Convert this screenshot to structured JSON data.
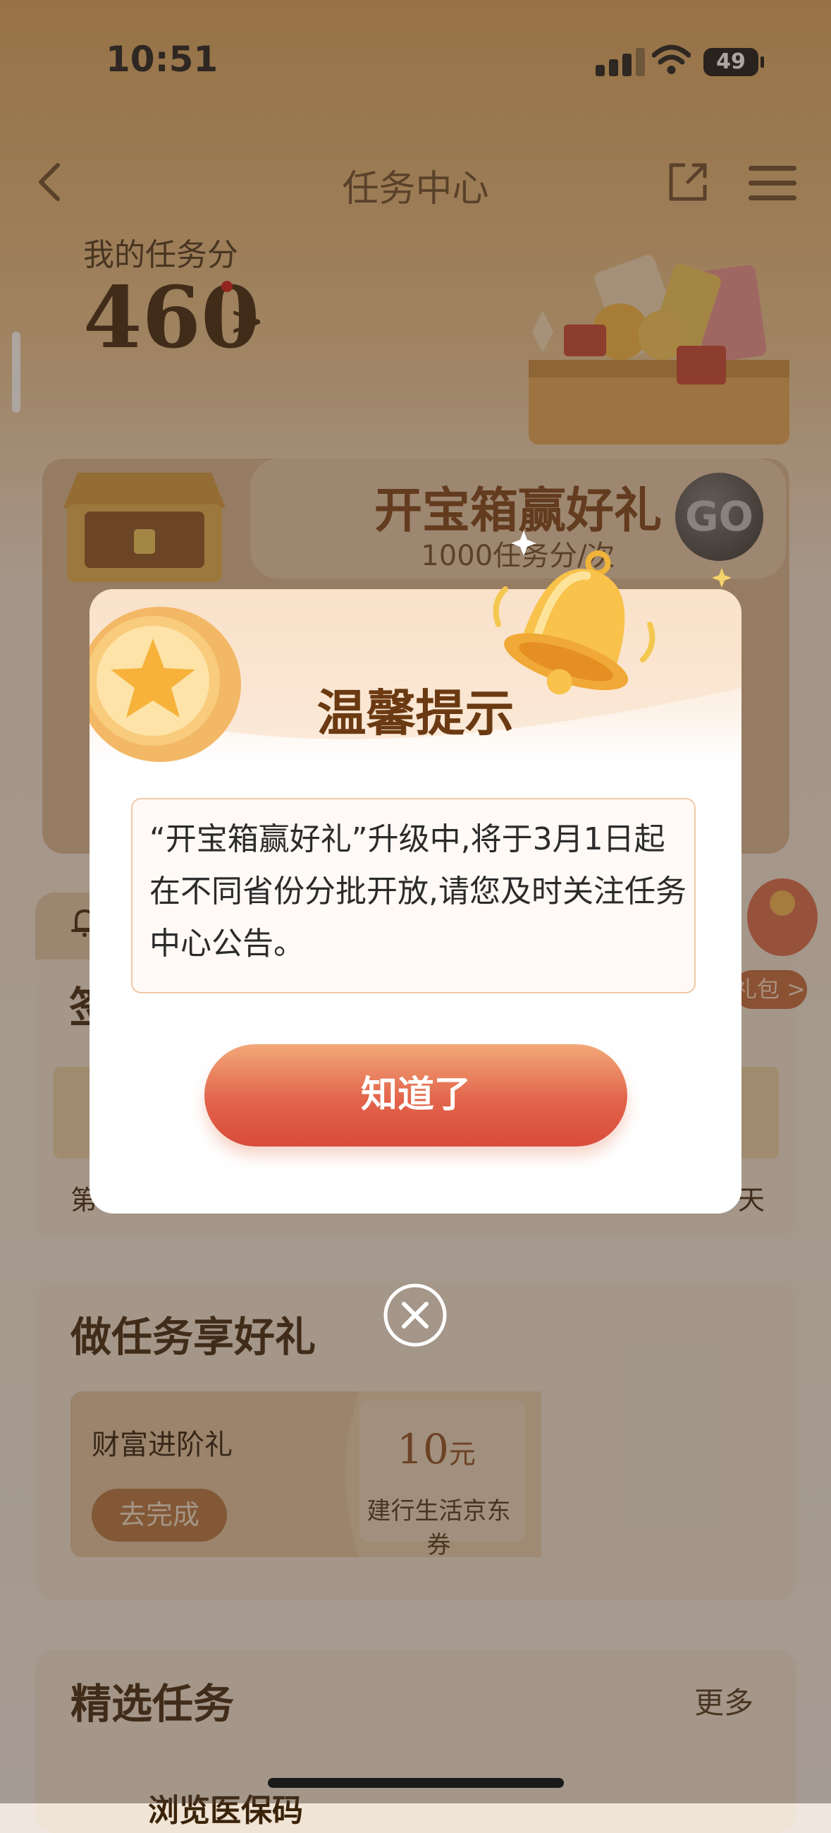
{
  "status_bar": {
    "time": "10:51",
    "battery": "49"
  },
  "header": {
    "title": "任务中心"
  },
  "score": {
    "label": "我的任务分",
    "value": "460",
    "arrow": ">"
  },
  "treasure_box": {
    "title": "开宝箱赢好礼",
    "subtitle": "1000任务分/次",
    "go_label": "GO"
  },
  "sign_in": {
    "title": "签",
    "day_left": "第",
    "day_right": "天",
    "gift_label": "礼包 >"
  },
  "tasks": {
    "title": "做任务享好礼",
    "item": {
      "name": "财富进阶礼",
      "button": "去完成",
      "amount": "10",
      "unit": "元",
      "desc": "建行生活京东券"
    }
  },
  "featured": {
    "title": "精选任务",
    "more": "更多",
    "first_item": "浏览医保码"
  },
  "modal": {
    "title": "温馨提示",
    "message": "“开宝箱赢好礼”升级中,将于3月1日起在不同省份分批开放,请您及时关注任务中心公告。",
    "ok_button": "知道了"
  },
  "colors": {
    "accent": "#e2644b",
    "brown": "#6b3a12",
    "dim": "rgba(70,55,45,0.45)"
  },
  "icons": [
    "back-icon",
    "share-icon",
    "menu-icon",
    "bell-icon",
    "star-coin-icon",
    "close-icon",
    "wifi-icon",
    "signal-icon"
  ]
}
